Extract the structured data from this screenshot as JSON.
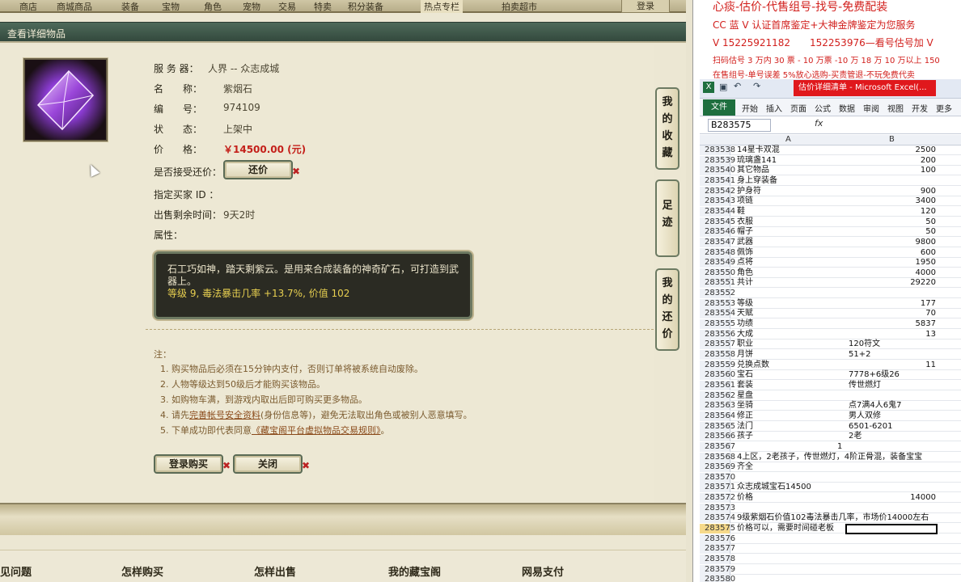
{
  "topnav": {
    "items": [
      "商店",
      "商城商品",
      "装备",
      "宝物",
      "角色",
      "宠物",
      "交易",
      "特卖",
      "积分装备",
      "热点专栏",
      "拍卖超市"
    ],
    "right": "登录"
  },
  "page": {
    "title": "查看详细物品"
  },
  "item": {
    "server_label": "服 务 器：",
    "server_value": "人界 -- 众志成城",
    "name_label": "名　　称：",
    "name_value": "紫烟石",
    "id_label": "编　　号：",
    "id_value": "974109",
    "status_label": "状　　态：",
    "status_value": "上架中",
    "price_label": "价　　格：",
    "price_value": "￥14500.00 (元)",
    "bargain_label": "是否接受还价：",
    "bargain_button": "还价",
    "buyer_label": "指定买家 ID ：",
    "remain_label": "出售剩余时间：",
    "remain_value": "9天2时",
    "attr_label": "属性：",
    "desc_text": "石工巧如神，踏天剩紫云。是用来合成装备的神奇矿石，可打造到武器上。",
    "desc_stats": "等级 9, 毒法暴击几率 +13.7%, 价值 102"
  },
  "notes": {
    "title": "注：",
    "n1": "1. 购买物品后必须在15分钟内支付，否则订单将被系统自动废除。",
    "n2": "2. 人物等级达到50级后才能购买该物品。",
    "n3": "3. 如购物车满，到游戏内取出后即可购买更多物品。",
    "n4a": "4. 请先",
    "n4link": "完善帐号安全资料",
    "n4b": "(身份信息等)，避免无法取出角色或被别人恶意填写。",
    "n5a": "5. 下单成功即代表同意",
    "n5link": "《藏宝阁平台虚拟物品交易规则》",
    "n5b": "。"
  },
  "actions": {
    "buy": "登录购买",
    "close": "关闭"
  },
  "sidetabs": {
    "fav": "我的收藏",
    "footprint": "足迹",
    "counter": "我的还价"
  },
  "footer": {
    "items": [
      "见问题",
      "怎样购买",
      "怎样出售",
      "我的藏宝阁",
      "网易支付"
    ]
  },
  "excel_ad": {
    "line1": "心痰-估价-代售组号-找号-免费配装",
    "line2": "CC 蓝 V 认证首席鉴定+大神金牌鉴定为您服务",
    "line3": "V 15225921182　　152253976—看号估号加 V",
    "line4": "扫码估号 3 万内 30 票 - 10 万票 -10 万 18 万 10 万以上 150",
    "line5": "在售组号-单号误差 5%放心选购-买责管退-不玩免费代卖"
  },
  "excel": {
    "window_title": "估价详细清单 - Microsoft Excel(...",
    "tabs": [
      "文件",
      "开始",
      "插入",
      "页面",
      "公式",
      "数据",
      "审阅",
      "视图",
      "开发",
      "更多"
    ],
    "namebox": "B283575",
    "fx": "fx",
    "col_a": "A",
    "col_b": "B",
    "rows": [
      {
        "n": "283538",
        "a": "14星卡双混",
        "b": "2500"
      },
      {
        "n": "283539",
        "a": "琉璃盏141",
        "b": "200"
      },
      {
        "n": "283540",
        "a": "其它物品",
        "b": "100"
      },
      {
        "n": "283541",
        "a": "身上穿装备",
        "b": ""
      },
      {
        "n": "283542",
        "a": "护身符",
        "b": "900"
      },
      {
        "n": "283543",
        "a": "项链",
        "b": "3400"
      },
      {
        "n": "283544",
        "a": "鞋",
        "b": "120"
      },
      {
        "n": "283545",
        "a": "衣服",
        "b": "50"
      },
      {
        "n": "283546",
        "a": "帽子",
        "b": "50"
      },
      {
        "n": "283547",
        "a": "武器",
        "b": "9800"
      },
      {
        "n": "283548",
        "a": "佩饰",
        "b": "600"
      },
      {
        "n": "283549",
        "a": "点将",
        "b": "1950"
      },
      {
        "n": "283550",
        "a": "角色",
        "b": "4000"
      },
      {
        "n": "283551",
        "a": "共计",
        "b": "29220"
      },
      {
        "n": "283552",
        "a": "",
        "b": ""
      },
      {
        "n": "283553",
        "a": "等级",
        "b": "177"
      },
      {
        "n": "283554",
        "a": "天赋",
        "b": "70"
      },
      {
        "n": "283555",
        "a": "功绩",
        "b": "5837"
      },
      {
        "n": "283556",
        "a": "大成",
        "b": "13"
      },
      {
        "n": "283557",
        "a": "职业",
        "bl": "120符文"
      },
      {
        "n": "283558",
        "a": "月饼",
        "bl": "51+2"
      },
      {
        "n": "283559",
        "a": "兑换点数",
        "b": "11"
      },
      {
        "n": "283560",
        "a": "宝石",
        "bl": "7778+6级26"
      },
      {
        "n": "283561",
        "a": "套装",
        "bl": "传世燃灯"
      },
      {
        "n": "283562",
        "a": "星盘",
        "b": ""
      },
      {
        "n": "283563",
        "a": "坐骑",
        "bl": "点7满4人6鬼7"
      },
      {
        "n": "283564",
        "a": "修正",
        "bl": "男人双修"
      },
      {
        "n": "283565",
        "a": "法门",
        "bl": "6501-6201"
      },
      {
        "n": "283566",
        "a": "孩子",
        "bl": "2老"
      },
      {
        "n": "283567",
        "a": "",
        "mid": "1"
      },
      {
        "n": "283568",
        "a": "4上区，2老孩子，传世燃灯，4阶正骨混，装备宝宝",
        "b": ""
      },
      {
        "n": "283569",
        "a": "齐全",
        "b": ""
      },
      {
        "n": "283570",
        "a": "",
        "b": ""
      },
      {
        "n": "283571",
        "a": "众志成城宝石14500",
        "b": ""
      },
      {
        "n": "283572",
        "a": "价格",
        "b": "14000"
      },
      {
        "n": "283573",
        "a": "",
        "b": ""
      },
      {
        "n": "283574",
        "a": "9级紫烟石价值102毒法暴击几率，市场价14000左右",
        "b": ""
      },
      {
        "n": "283575",
        "a": "价格可以，需要时间碰老板",
        "b": "",
        "active": true
      },
      {
        "n": "283576",
        "a": "",
        "b": ""
      },
      {
        "n": "283577",
        "a": "",
        "b": ""
      },
      {
        "n": "283578",
        "a": "",
        "b": ""
      },
      {
        "n": "283579",
        "a": "",
        "b": ""
      },
      {
        "n": "283580",
        "a": "",
        "b": ""
      }
    ]
  },
  "colors": {
    "accent": "#c4201a",
    "panel_border": "#6c7a62",
    "title_bar": "#3f594b"
  },
  "icons": {
    "item_thumb": "gem-icon",
    "bargain_x": "close-icon"
  }
}
